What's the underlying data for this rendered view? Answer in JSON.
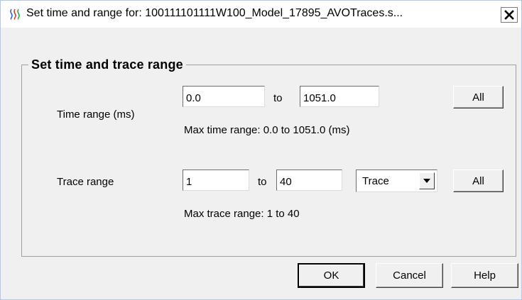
{
  "window": {
    "title": "Set time and range for:  100111101111W100_Model_17895_AVOTraces.s..."
  },
  "group": {
    "title": "Set time and trace range"
  },
  "time_range": {
    "label": "Time range (ms)",
    "start_value": "0.0",
    "to_label": "to",
    "end_value": "1051.0",
    "all_label": "All",
    "max_text": "Max time range: 0.0 to 1051.0 (ms)"
  },
  "trace_range": {
    "label": "Trace range",
    "start_value": "1",
    "to_label": "to",
    "end_value": "40",
    "unit_selected": "Trace",
    "all_label": "All",
    "max_text": "Max trace range: 1 to 40"
  },
  "buttons": {
    "ok": "OK",
    "cancel": "Cancel",
    "help": "Help"
  }
}
